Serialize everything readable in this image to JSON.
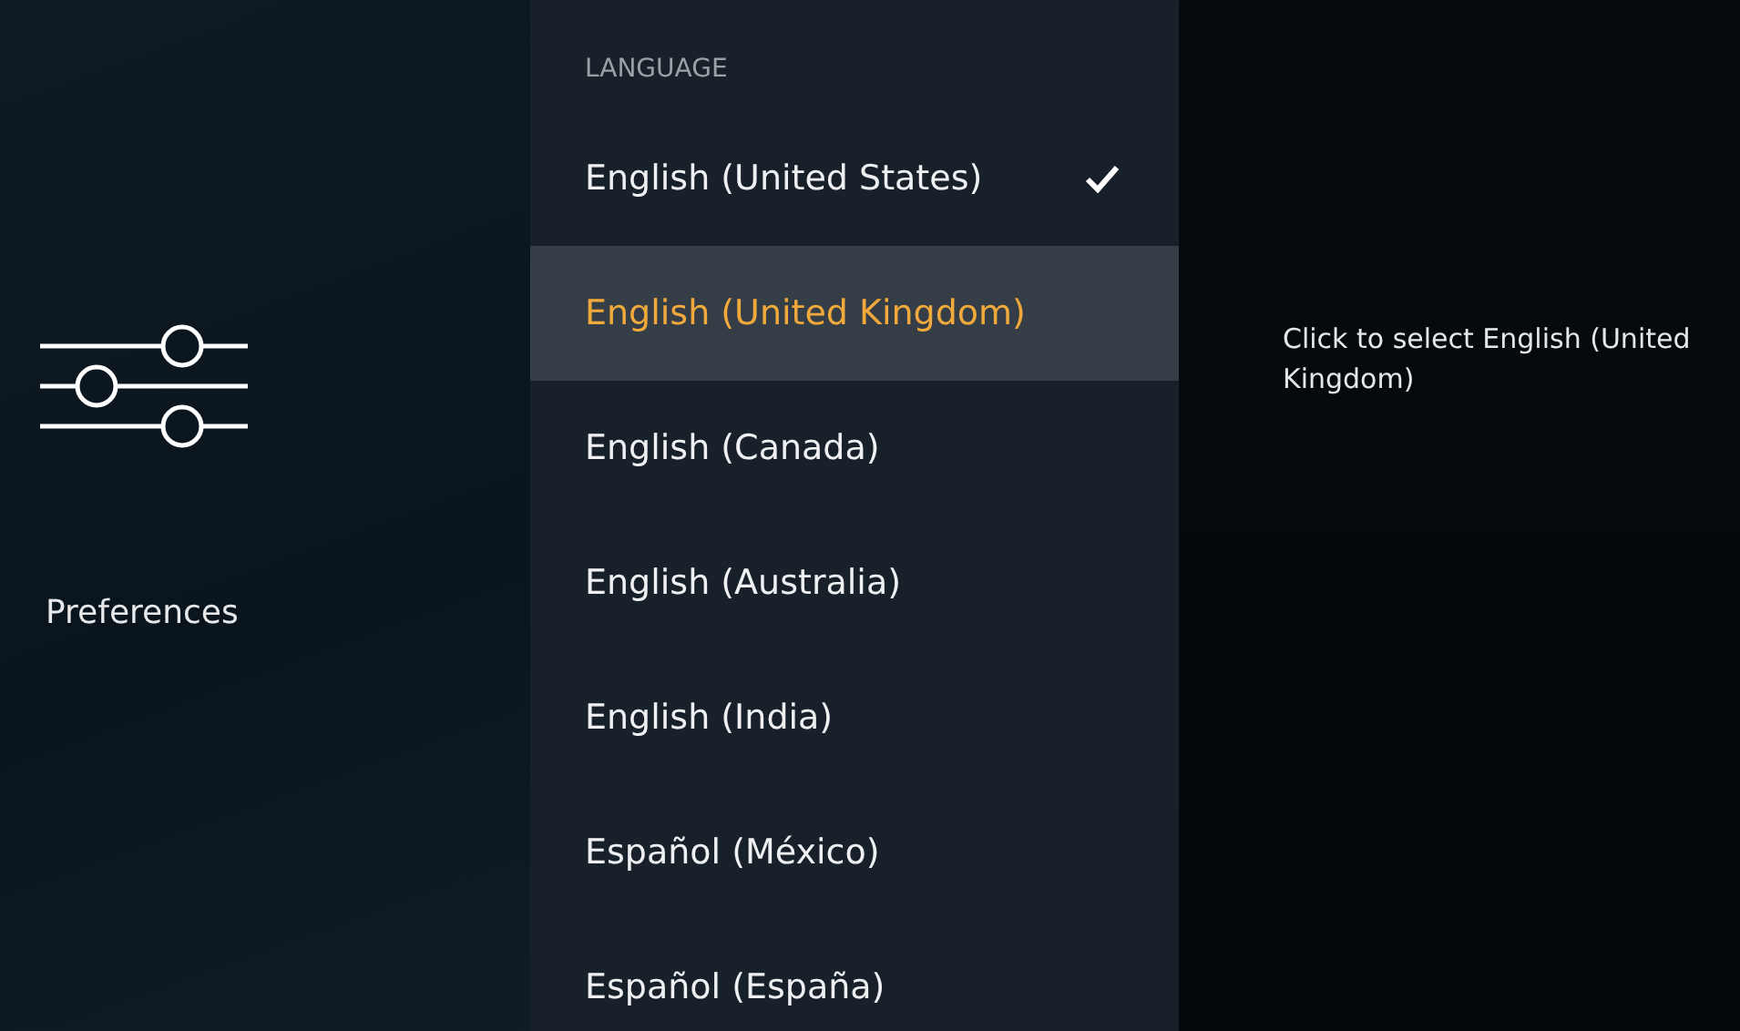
{
  "category": {
    "label": "Preferences"
  },
  "menu": {
    "heading": "LANGUAGE",
    "items": [
      {
        "label": "English (United States)",
        "selected": false,
        "checked": true
      },
      {
        "label": "English (United Kingdom)",
        "selected": true,
        "checked": false
      },
      {
        "label": "English (Canada)",
        "selected": false,
        "checked": false
      },
      {
        "label": "English (Australia)",
        "selected": false,
        "checked": false
      },
      {
        "label": "English (India)",
        "selected": false,
        "checked": false
      },
      {
        "label": "Español (México)",
        "selected": false,
        "checked": false
      },
      {
        "label": "Español (España)",
        "selected": false,
        "checked": false
      }
    ]
  },
  "description": "Click to select English (United Kingdom)"
}
